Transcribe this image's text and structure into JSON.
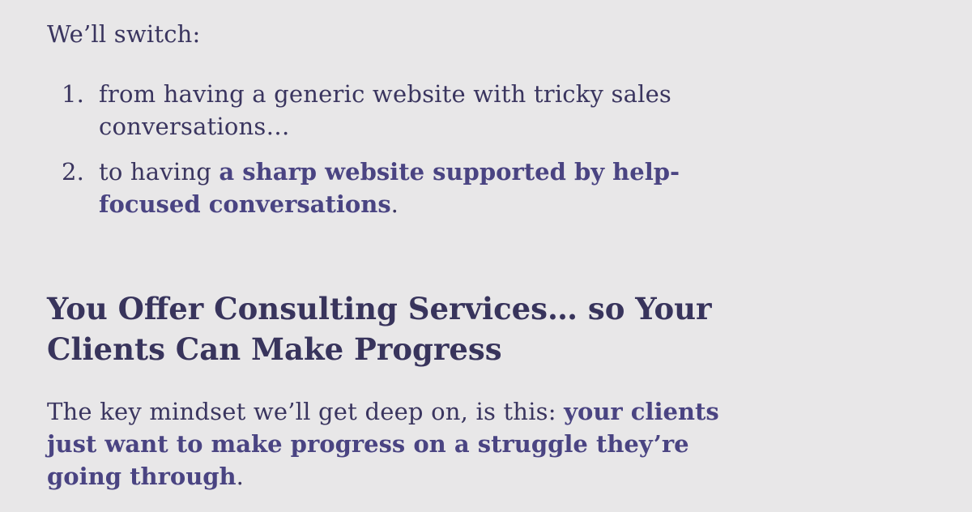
{
  "intro": {
    "text": "We’ll switch:"
  },
  "switch_list": [
    {
      "number": "1.",
      "text": "from having a generic website with tricky sales conversations…"
    },
    {
      "number": "2.",
      "prefix": "to having ",
      "emphasis": "a sharp website supported by help-focused conversations",
      "suffix": "."
    }
  ],
  "section": {
    "heading": "You Offer Consulting Services… so Your Clients Can Make Progress",
    "body_prefix": "The key mindset we’ll get deep on, is this: ",
    "body_emphasis": "your clients just want to make progress on a struggle they’re going through",
    "body_suffix": "."
  },
  "colors": {
    "background": "#e8e7e8",
    "text": "#3a355f",
    "emphasis": "#4a4482"
  }
}
